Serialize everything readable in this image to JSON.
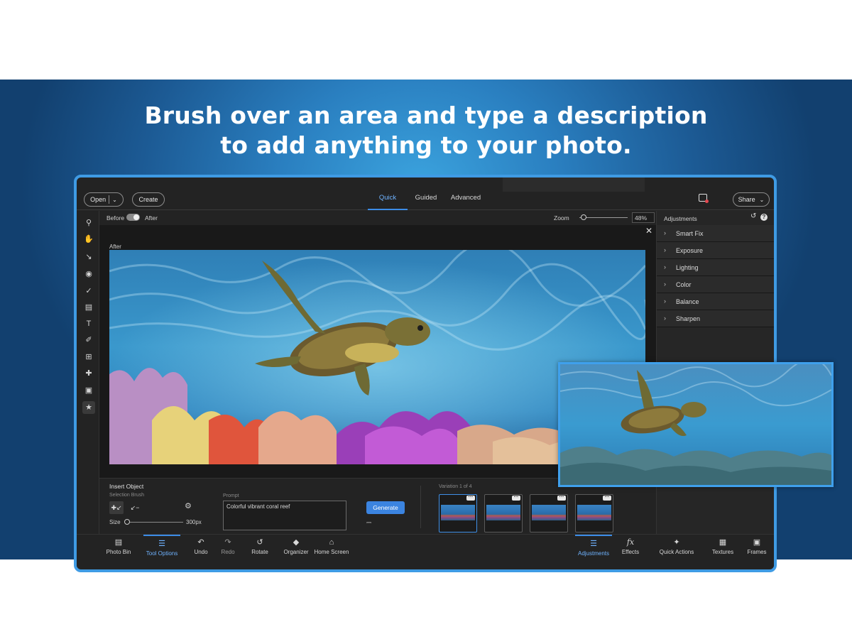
{
  "headline": {
    "line1": "Brush over an area and type a description",
    "line2": "to add anything to your photo."
  },
  "topbar": {
    "open_label": "Open",
    "create_label": "Create",
    "tabs": [
      "Quick",
      "Guided",
      "Advanced"
    ],
    "active_tab": "Quick",
    "share_label": "Share"
  },
  "options": {
    "before_label": "Before",
    "after_label": "After",
    "zoom_label": "Zoom",
    "zoom_value": "48%"
  },
  "canvas": {
    "view_label": "After"
  },
  "adjustments": {
    "title": "Adjustments",
    "items": [
      "Smart Fix",
      "Exposure",
      "Lighting",
      "Color",
      "Balance",
      "Sharpen"
    ]
  },
  "insert_object": {
    "title": "Insert Object",
    "selection_brush_label": "Selection Brush",
    "size_label": "Size",
    "size_value": "300px",
    "size_fraction": 0.0,
    "prompt_label": "Prompt",
    "prompt_value": "Colorful vibrant coral reef",
    "generate_label": "Generate",
    "variation_label": "Variation 1 of 4"
  },
  "bottom_left": [
    {
      "label": "Photo Bin",
      "icon": "photo-bin-icon"
    },
    {
      "label": "Tool Options",
      "icon": "tool-options-icon"
    },
    {
      "label": "Undo",
      "icon": "undo-icon"
    },
    {
      "label": "Redo",
      "icon": "redo-icon"
    },
    {
      "label": "Rotate",
      "icon": "rotate-icon"
    },
    {
      "label": "Organizer",
      "icon": "organizer-icon"
    },
    {
      "label": "Home Screen",
      "icon": "home-icon"
    }
  ],
  "bottom_right": [
    {
      "label": "Adjustments",
      "icon": "adjustments-icon"
    },
    {
      "label": "Effects",
      "icon": "effects-icon"
    },
    {
      "label": "Quick Actions",
      "icon": "quick-actions-icon"
    },
    {
      "label": "Textures",
      "icon": "textures-icon"
    },
    {
      "label": "Frames",
      "icon": "frames-icon"
    }
  ],
  "colors": {
    "accent": "#3c8ce7",
    "frame_border": "#3f9be4",
    "generate_button": "#3b84e0",
    "app_background": "#232323"
  }
}
